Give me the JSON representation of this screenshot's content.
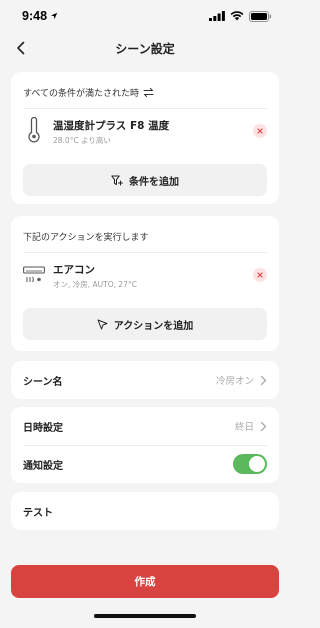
{
  "status_bar": {
    "time": "9:48"
  },
  "nav": {
    "title": "シーン設定"
  },
  "conditions": {
    "header": "すべての条件が満たされた時",
    "item": {
      "title": "温湿度計プラス F8 温度",
      "subtitle": "28.0°C より高い"
    },
    "add_label": "条件を追加"
  },
  "actions": {
    "header": "下記のアクションを実行します",
    "item": {
      "title": "エアコン",
      "subtitle": "オン, 冷房, AUTO, 27°C"
    },
    "add_label": "アクションを追加"
  },
  "scene_name": {
    "label": "シーン名",
    "value": "冷房オン"
  },
  "schedule": {
    "label": "日時設定",
    "value": "終日"
  },
  "notification": {
    "label": "通知設定",
    "enabled": true
  },
  "test": {
    "label": "テスト"
  },
  "create_button": {
    "label": "作成"
  },
  "colors": {
    "accent": "#d9433f",
    "toggle_on": "#5cb85c",
    "delete_bg": "#fde2e2",
    "delete_icon": "#e0474c"
  }
}
